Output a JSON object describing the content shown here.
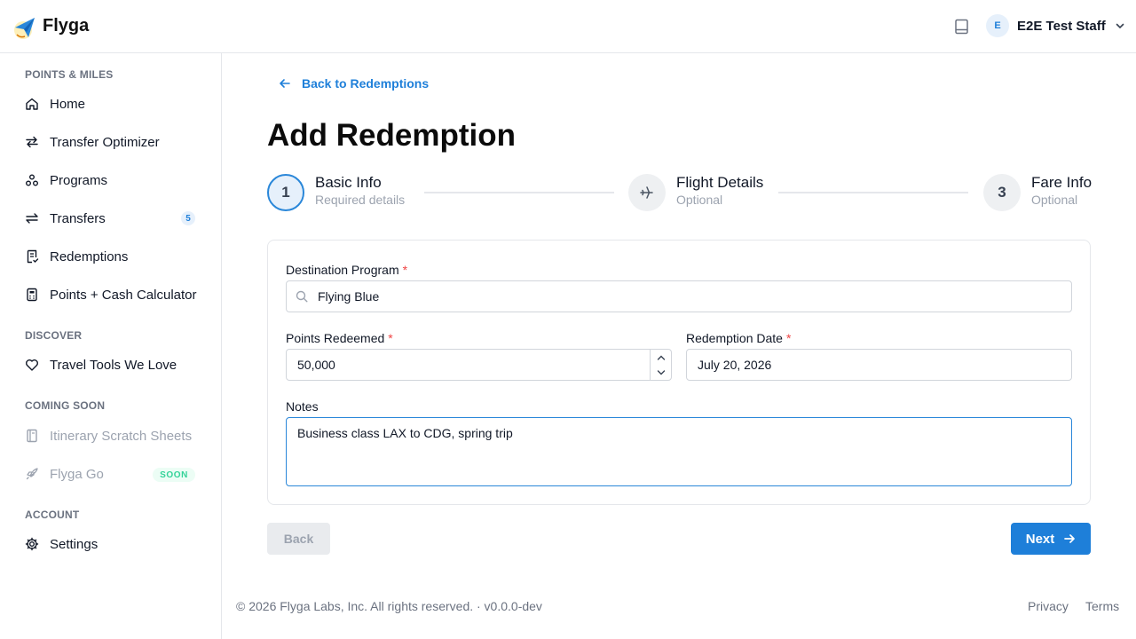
{
  "app": {
    "brand": "Flyga"
  },
  "header": {
    "user_initial": "E",
    "user_name": "E2E Test Staff"
  },
  "sidebar": {
    "sections": {
      "points_miles": "POINTS & MILES",
      "discover": "DISCOVER",
      "coming_soon": "COMING SOON",
      "account": "ACCOUNT"
    },
    "items": {
      "home": "Home",
      "transfer_optimizer": "Transfer Optimizer",
      "programs": "Programs",
      "transfers": "Transfers",
      "transfers_count": "5",
      "redemptions": "Redemptions",
      "calculator": "Points + Cash Calculator",
      "travel_tools": "Travel Tools We Love",
      "itinerary": "Itinerary Scratch Sheets",
      "flyga_go": "Flyga Go",
      "soon_badge": "SOON",
      "settings": "Settings"
    }
  },
  "main": {
    "back_link": "Back to Redemptions",
    "title": "Add Redemption",
    "steps": [
      {
        "number": "1",
        "title": "Basic Info",
        "subtitle": "Required details"
      },
      {
        "number": "2",
        "title": "Flight Details",
        "subtitle": "Optional"
      },
      {
        "number": "3",
        "title": "Fare Info",
        "subtitle": "Optional"
      }
    ],
    "form": {
      "destination_label": "Destination Program",
      "destination_value": "Flying Blue",
      "points_label": "Points Redeemed",
      "points_value": "50,000",
      "date_label": "Redemption Date",
      "date_value": "July 20, 2026",
      "notes_label": "Notes",
      "notes_value": "Business class LAX to CDG, spring trip",
      "required_mark": "*"
    },
    "buttons": {
      "back": "Back",
      "next": "Next"
    }
  },
  "footer": {
    "copyright": "© 2026 Flyga Labs, Inc. All rights reserved. · v0.0.0-dev",
    "privacy": "Privacy",
    "terms": "Terms"
  },
  "colors": {
    "accent": "#1e7fd9",
    "required": "#ef4444",
    "soon": "#34d399"
  }
}
